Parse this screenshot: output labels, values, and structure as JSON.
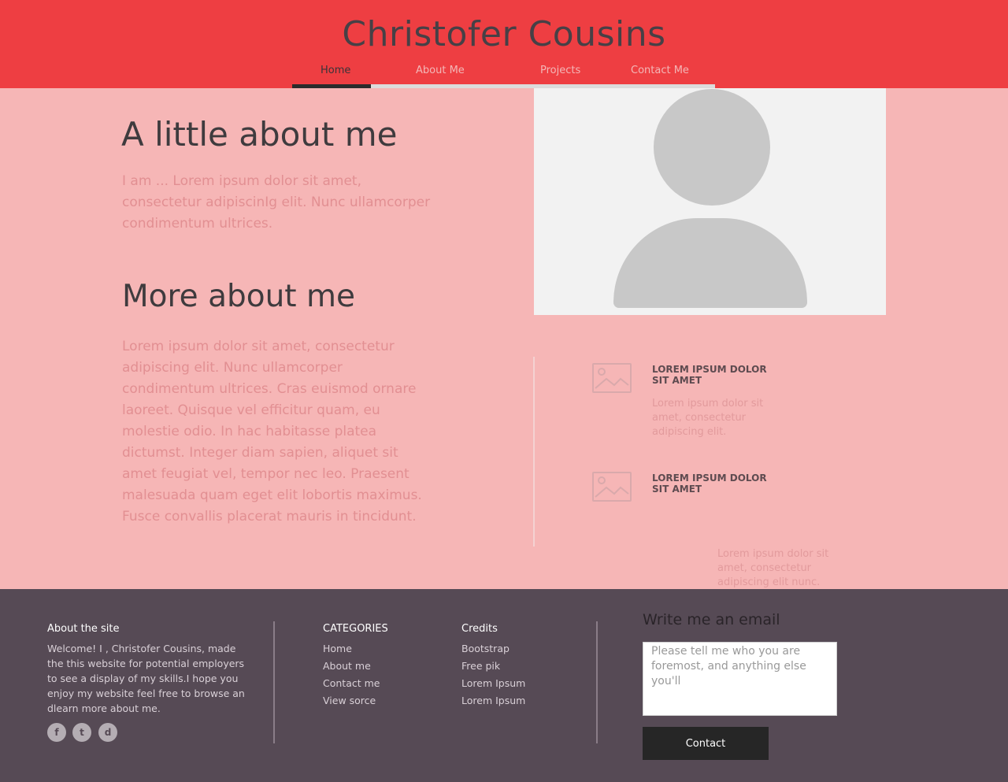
{
  "header": {
    "title": "Christofer Cousins",
    "bg_color": "#ee3e42",
    "nav": {
      "home": "Home",
      "about": "About Me",
      "projects": "Projects",
      "contact": "Contact Me",
      "active": "Home"
    }
  },
  "main": {
    "about_heading": "A little about me",
    "about_text": "I am ... Lorem ipsum dolor sit amet, consectetur adipiscinIg elit. Nunc ullamcorper condimentum ultrices.",
    "more_heading": "More about me",
    "more_text": "Lorem ipsum dolor sit amet, consectetur adipiscing elit. Nunc ullamcorper condimentum ultrices. Cras euismod ornare laoreet. Quisque vel efficitur quam, eu molestie odio. In hac habitasse platea dictumst. Integer diam sapien, aliquet sit amet feugiat vel, tempor nec leo. Praesent malesuada quam eget elit lobortis maximus. Fusce convallis placerat mauris in tincidunt.",
    "features": [
      {
        "title": "LOREM IPSUM DOLOR SIT AMET",
        "text": "Lorem ipsum dolor sit amet, consectetur adipiscing elit."
      },
      {
        "title": "LOREM IPSUM DOLOR SIT AMET",
        "text": "Lorem ipsum dolor sit amet, consectetur adipiscing elit nunc."
      }
    ]
  },
  "footer": {
    "about_heading": "About the site",
    "about_text": "Welcome! I , Christofer Cousins, made the this website for potential employers to see a display of my skills.I hope you enjoy my website feel free to browse an dlearn more about me.",
    "categories_heading": "CATEGORIES",
    "categories": [
      "Home",
      "About me",
      "Contact me",
      "View sorce"
    ],
    "credits_heading": "Credits",
    "credits": [
      "Bootstrap",
      "Free pik",
      "Lorem Ipsum",
      "Lorem Ipsum"
    ],
    "social": {
      "facebook": "f",
      "twitter": "t",
      "dribbble": "d"
    },
    "email_heading": "Write me an email",
    "email_placeholder": "Please tell me who you are foremost, and anything else you'll",
    "contact_button": "Contact"
  },
  "colors": {
    "accent": "#ee3e42",
    "page_bg": "#f6b6b6",
    "footer_bg": "#564a55",
    "dark": "#262626"
  }
}
